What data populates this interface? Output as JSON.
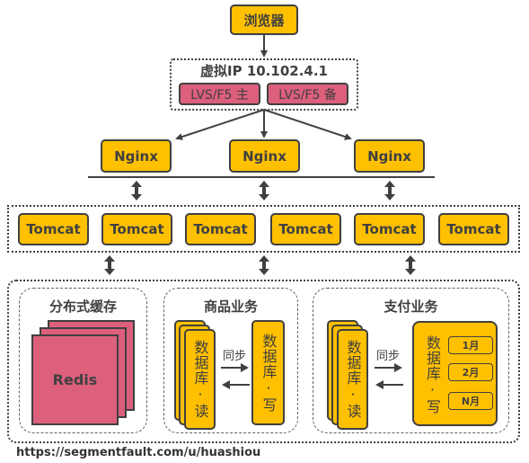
{
  "diagram": {
    "browser": "浏览器",
    "vip": {
      "title": "虚拟IP 10.102.4.1",
      "lb_master": "LVS/F5 主",
      "lb_backup": "LVS/F5 备"
    },
    "nginx": [
      "Nginx",
      "Nginx",
      "Nginx"
    ],
    "tomcat": [
      "Tomcat",
      "Tomcat",
      "Tomcat",
      "Tomcat",
      "Tomcat",
      "Tomcat"
    ],
    "cache": {
      "title": "分布式缓存",
      "node": "Redis"
    },
    "product": {
      "title": "商品业务",
      "db_read": "数据库·读",
      "db_write": "数据库·写",
      "sync": "同步"
    },
    "payment": {
      "title": "支付业务",
      "db_read": "数据库·读",
      "db_write": "数据库·写",
      "sync": "同步",
      "shards": [
        "1月",
        "2月",
        "N月"
      ]
    },
    "watermark": "https://segmentfault.com/u/huashiou"
  },
  "colors": {
    "server_fill": "#ffc000",
    "lb_fill": "#dc5f7c",
    "stroke": "#404040"
  }
}
